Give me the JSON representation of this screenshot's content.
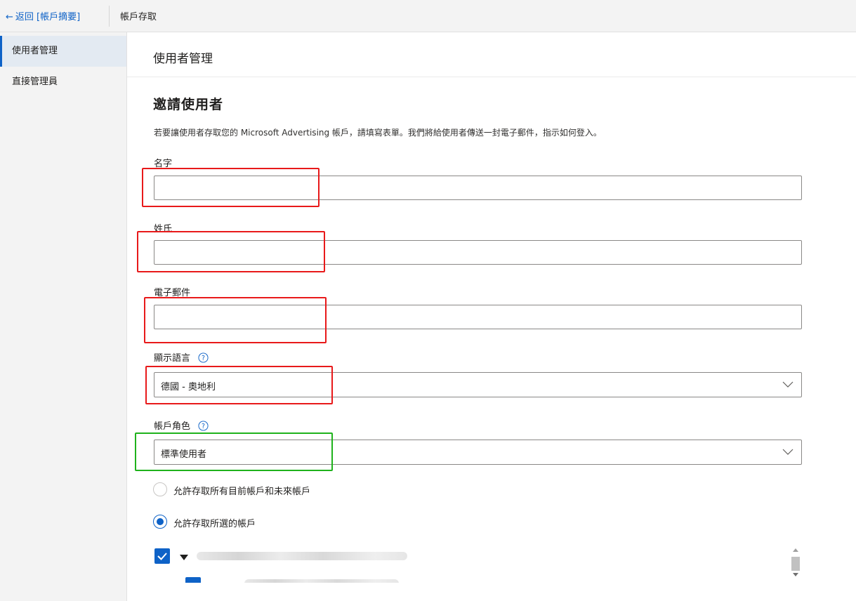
{
  "topbar": {
    "back_arrow": "←",
    "back_label": "返回 [帳戶摘要]",
    "title": "帳戶存取"
  },
  "sidebar": {
    "items": [
      {
        "label": "使用者管理",
        "active": true
      },
      {
        "label": "直接管理員",
        "active": false
      }
    ]
  },
  "section": {
    "title": "使用者管理"
  },
  "form": {
    "heading": "邀請使用者",
    "description": "若要讓使用者存取您的 Microsoft Advertising 帳戶，請填寫表單。我們將給使用者傳送一封電子郵件，指示如何登入。",
    "first_name": {
      "label": "名字",
      "value": ""
    },
    "last_name": {
      "label": "姓氏",
      "value": ""
    },
    "email": {
      "label": "電子郵件",
      "value": ""
    },
    "display_language": {
      "label": "顯示語言",
      "value": "德國 - 奧地利"
    },
    "account_role": {
      "label": "帳戶角色",
      "value": "標準使用者"
    },
    "access_options": [
      {
        "label": "允許存取所有目前帳戶和未來帳戶",
        "checked": false
      },
      {
        "label": "允許存取所選的帳戶",
        "checked": true
      }
    ]
  },
  "colors": {
    "accent": "#0e62c7",
    "highlight_red": "#e8191a",
    "highlight_green": "#1fb21c",
    "sidebar_bg": "#f3f3f3"
  },
  "icons": [
    "back-arrow-icon",
    "help-icon",
    "chevron-down-icon",
    "checkmark-icon",
    "caret-down-icon"
  ]
}
